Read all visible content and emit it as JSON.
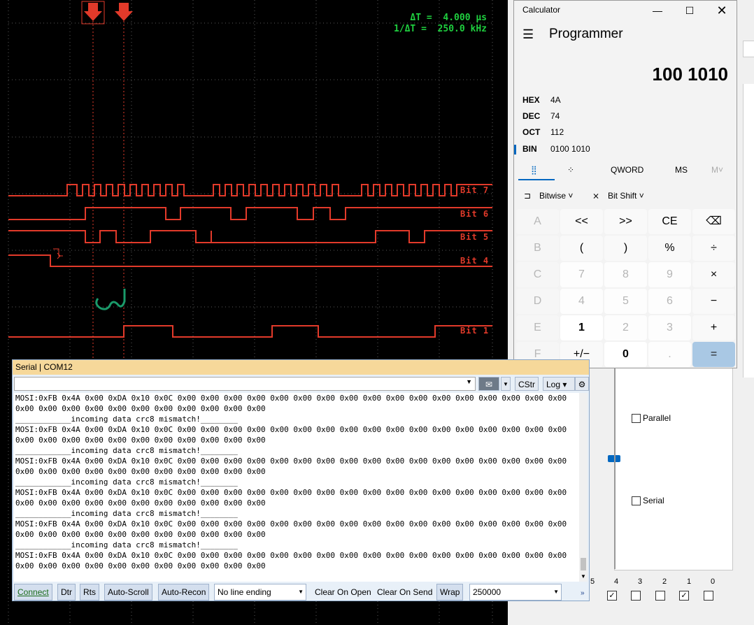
{
  "scope": {
    "delta_t": "ΔT =  4.000 µs",
    "inv_delta_t": "1/ΔT =  250.0 kHz",
    "channels": [
      "Bit 7",
      "Bit 6",
      "Bit 5",
      "Bit 4",
      "Bit 1"
    ],
    "colors": {
      "background": "#000000",
      "trace": "#e23a2a",
      "grid": "#5a5a5a",
      "readout": "#1fcf3f",
      "annotation": "#1a9a6a"
    }
  },
  "calculator": {
    "title": "Calculator",
    "mode": "Programmer",
    "display": "100 1010",
    "radix": [
      {
        "name": "HEX",
        "value": "4A"
      },
      {
        "name": "DEC",
        "value": "74"
      },
      {
        "name": "OCT",
        "value": "112"
      },
      {
        "name": "BIN",
        "value": "0100 1010"
      }
    ],
    "word_size": "QWORD",
    "memory": [
      "MS",
      "M˅"
    ],
    "bitwise": "Bitwise",
    "bitshift": "Bit Shift",
    "keys": [
      [
        "A",
        "<<",
        ">>",
        "CE",
        "⌫"
      ],
      [
        "B",
        "(",
        ")",
        "%",
        "÷"
      ],
      [
        "C",
        "7",
        "8",
        "9",
        "×"
      ],
      [
        "D",
        "4",
        "5",
        "6",
        "−"
      ],
      [
        "E",
        "1",
        "2",
        "3",
        "+"
      ],
      [
        "F",
        "+/−",
        "0",
        ".",
        "="
      ]
    ]
  },
  "panel": {
    "parallel": "Parallel",
    "serial": "Serial",
    "bit_numbers": [
      "5",
      "4",
      "3",
      "2",
      "1",
      "0"
    ]
  },
  "serial": {
    "title": "Serial | COM12",
    "cstr": "CStr",
    "log": "Log",
    "mosi_line": "MOSI:0xFB 0x4A 0x00 0xDA 0x10 0x0C 0x00 0x00 0x00 0x00 0x00 0x00 0x00 0x00 0x00 0x00 0x00 0x00 0x00 0x00 0x00 0x00 0x00",
    "zero_line": "0x00 0x00 0x00 0x00 0x00 0x00 0x00 0x00 0x00 0x00 0x00",
    "mismatch_line": "____________incoming data crc8 mismatch!________",
    "connect": "Connect",
    "dtr": "Dtr",
    "rts": "Rts",
    "autoscroll": "Auto-Scroll",
    "autorecon": "Auto-Recon",
    "line_ending": "No line ending",
    "clear_on_open": "Clear On Open",
    "clear_on_send": "Clear On Send",
    "wrap": "Wrap",
    "baud": "250000"
  }
}
